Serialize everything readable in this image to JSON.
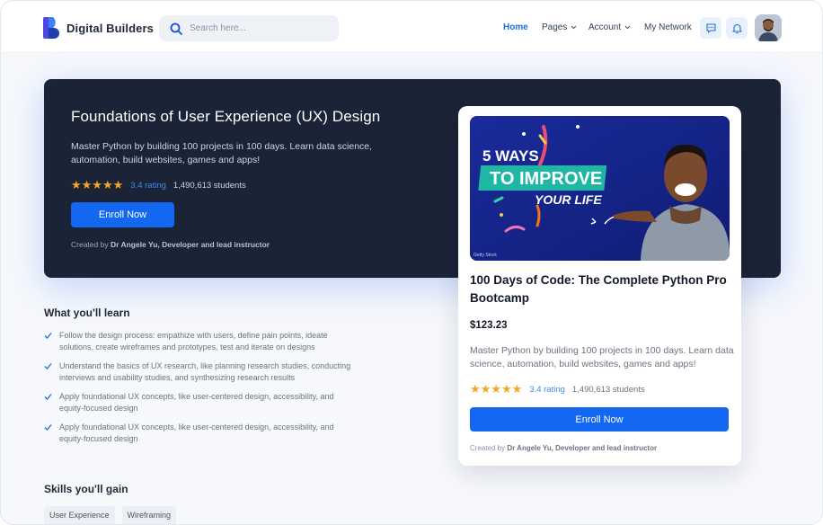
{
  "brand": {
    "name": "Digital Builders",
    "color": "#2563eb"
  },
  "search": {
    "placeholder": "Search here..."
  },
  "nav": {
    "home": "Home",
    "pages": "Pages",
    "account": "Account",
    "network": "My Network"
  },
  "header_icons": [
    "chat-icon",
    "bell-icon"
  ],
  "hero": {
    "title": "Foundations of User Experience (UX) Design",
    "description": "Master Python by building 100 projects in 100 days. Learn data science, automation, build websites, games and apps!",
    "stars": "★★★★★",
    "rating": "3.4 rating",
    "students": "1,490,613 students",
    "enroll": "Enroll Now",
    "created_prefix": "Created by ",
    "created_by": "Dr Angele Yu, Developer and lead instructor"
  },
  "card": {
    "thumbnail": {
      "line1": "5 WAYS",
      "line2": "TO IMPROVE",
      "line3": "YOUR LIFE",
      "credit": "Getty Stock"
    },
    "title": "100 Days of Code: The Complete Python Pro Bootcamp",
    "price": "$123.23",
    "description": "Master Python by building 100 projects in 100 days. Learn data science, automation, build websites, games and apps!",
    "stars": "★★★★★",
    "rating": "3.4 rating",
    "students": "1,490,613 students",
    "enroll": "Enroll Now",
    "created_prefix": "Created by ",
    "created_by": "Dr Angele Yu, Developer and lead instructor"
  },
  "learn": {
    "title": "What you'll learn",
    "items": [
      "Follow the design process: empathize with users, define pain points, ideate solutions, create wireframes and prototypes, test and iterate on designs",
      "Understand the basics of UX research, like planning research studies, conducting interviews and usability studies, and synthesizing research results",
      "Apply foundational UX concepts, like user-centered design, accessibility, and equity-focused design",
      "Apply foundational UX concepts, like user-centered design, accessibility, and equity-focused design"
    ]
  },
  "skills": {
    "title": "Skills you'll gain",
    "items": [
      "User Experience",
      "Wireframing"
    ]
  },
  "colors": {
    "accent": "#1467f0",
    "hero_bg": "#1b2436",
    "star": "#f5a623",
    "rating_link": "#3b8bf0",
    "check": "#1d6fd8"
  }
}
